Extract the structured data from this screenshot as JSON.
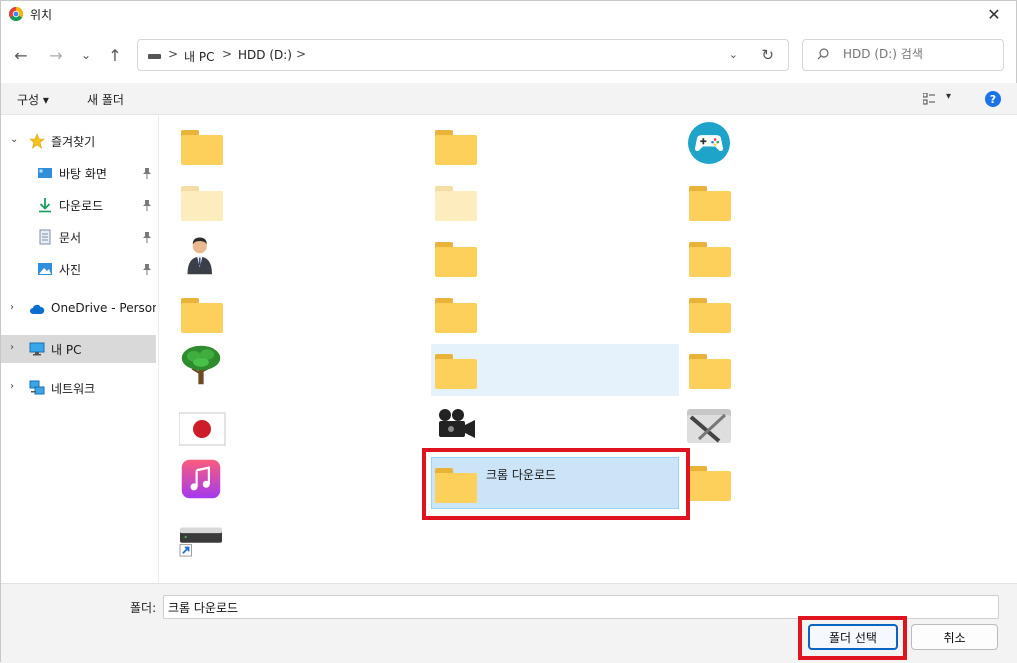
{
  "window": {
    "title": "위치",
    "close_glyph": "✕"
  },
  "nav": {
    "back_glyph": "←",
    "forward_glyph": "→",
    "recent_glyph": "⌄",
    "up_glyph": "↑",
    "breadcrumbs": [
      "내 PC",
      "HDD (D:)"
    ],
    "separator": ">",
    "dropdown_glyph": "⌄",
    "refresh_glyph": "↻"
  },
  "search": {
    "placeholder": "HDD (D:) 검색"
  },
  "toolbar": {
    "organize_label": "구성 ▾",
    "new_folder_label": "새 폴더",
    "view_dropdown_glyph": "▾",
    "help_glyph": "?"
  },
  "sidebar": {
    "items": [
      {
        "label": "즐겨찾기",
        "icon": "star-icon",
        "expanded": true
      },
      {
        "label": "바탕 화면",
        "icon": "desktop-icon",
        "pinned": true
      },
      {
        "label": "다운로드",
        "icon": "download-icon",
        "pinned": true
      },
      {
        "label": "문서",
        "icon": "document-icon",
        "pinned": true
      },
      {
        "label": "사진",
        "icon": "picture-icon",
        "pinned": true
      },
      {
        "label": "OneDrive - Persona",
        "icon": "cloud-icon"
      },
      {
        "label": "내 PC",
        "icon": "pc-icon",
        "selected": true
      },
      {
        "label": "네트워크",
        "icon": "network-icon"
      }
    ],
    "expand_glyph": "›",
    "collapse_glyph": "⌄",
    "pin_glyph": "📌"
  },
  "content": {
    "tiles": [
      {
        "icon": "folder-icon",
        "label": ""
      },
      {
        "icon": "folder-icon",
        "label": ""
      },
      {
        "icon": "gamepad-icon",
        "label": ""
      },
      {
        "icon": "folder-faded-icon",
        "label": ""
      },
      {
        "icon": "folder-faded-icon",
        "label": ""
      },
      {
        "icon": "folder-icon",
        "label": ""
      },
      {
        "icon": "user-avatar-icon",
        "label": ""
      },
      {
        "icon": "folder-icon",
        "label": ""
      },
      {
        "icon": "folder-icon",
        "label": ""
      },
      {
        "icon": "folder-icon",
        "label": ""
      },
      {
        "icon": "folder-icon",
        "label": ""
      },
      {
        "icon": "folder-icon",
        "label": ""
      },
      {
        "icon": "tree-icon",
        "label": ""
      },
      {
        "icon": "folder-icon",
        "label": ""
      },
      {
        "icon": "folder-icon",
        "label": ""
      },
      {
        "icon": "japan-flag-icon",
        "label": ""
      },
      {
        "icon": "movie-camera-icon",
        "label": ""
      },
      {
        "icon": "tools-folder-icon",
        "label": ""
      },
      {
        "icon": "music-app-icon",
        "label": ""
      },
      {
        "icon": "folder-icon",
        "label": "크롬 다운로드"
      },
      {
        "icon": "folder-icon",
        "label": ""
      },
      {
        "icon": "drive-shortcut-icon",
        "label": ""
      }
    ],
    "selected_label": "크롬 다운로드"
  },
  "bottom": {
    "folder_label": "폴더:",
    "folder_value": "크롬 다운로드",
    "select_button": "폴더 선택",
    "cancel_button": "취소"
  },
  "colors": {
    "accent": "#0a64c4",
    "highlight_red": "#e0141e",
    "folder_yellow": "#fcd05a",
    "selected_bg": "#cce4f7"
  }
}
